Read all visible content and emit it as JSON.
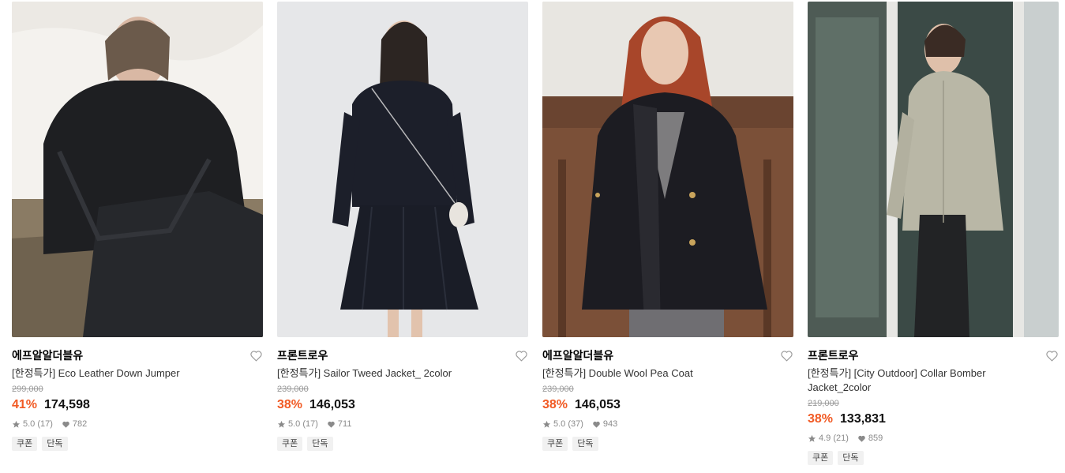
{
  "products": [
    {
      "brand": "에프알알더블유",
      "name": "[한정특가] Eco Leather Down Jumper",
      "original_price": "299,000",
      "discount": "41%",
      "price": "174,598",
      "rating": "5.0 (17)",
      "likes": "782",
      "tags": [
        "쿠폰",
        "단독"
      ],
      "photo_icon": "product-photo-puffer-jacket"
    },
    {
      "brand": "프론트로우",
      "name": "[한정특가] Sailor Tweed Jacket_ 2color",
      "original_price": "239,000",
      "discount": "38%",
      "price": "146,053",
      "rating": "5.0 (17)",
      "likes": "711",
      "tags": [
        "쿠폰",
        "단독"
      ],
      "photo_icon": "product-photo-tweed-jacket"
    },
    {
      "brand": "에프알알더블유",
      "name": "[한정특가] Double Wool Pea Coat",
      "original_price": "239,000",
      "discount": "38%",
      "price": "146,053",
      "rating": "5.0 (37)",
      "likes": "943",
      "tags": [
        "쿠폰",
        "단독"
      ],
      "photo_icon": "product-photo-pea-coat"
    },
    {
      "brand": "프론트로우",
      "name": "[한정특가] [City Outdoor] Collar Bomber Jacket_2color",
      "original_price": "219,000",
      "discount": "38%",
      "price": "133,831",
      "rating": "4.9 (21)",
      "likes": "859",
      "tags": [
        "쿠폰",
        "단독"
      ],
      "photo_icon": "product-photo-bomber-jacket"
    }
  ],
  "colors": {
    "discount": "#f15a24",
    "strike": "#9a9a9a",
    "tag_bg": "#f1f1f1"
  }
}
